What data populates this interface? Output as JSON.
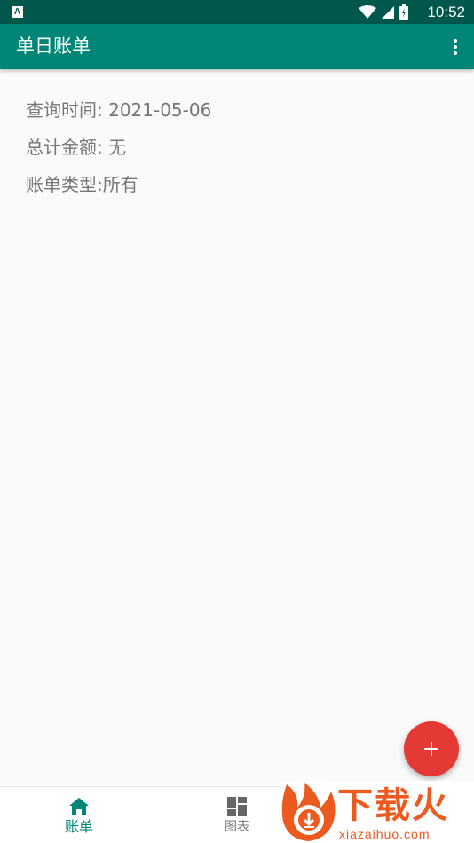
{
  "status_bar": {
    "time": "10:52",
    "notification_icon": "A"
  },
  "app_bar": {
    "title": "单日账单"
  },
  "summary": {
    "query_time": "查询时间:  2021-05-06",
    "total_amount": "总计金额:  无",
    "bill_type": "账单类型:所有"
  },
  "bottom_nav": {
    "items": [
      {
        "label": "账单",
        "icon": "home-icon",
        "active": true
      },
      {
        "label": "图表",
        "icon": "dashboard-icon",
        "active": false
      }
    ]
  },
  "watermark": {
    "title": "下载火",
    "subtitle": "xiazaihuo.com"
  },
  "colors": {
    "primary": "#008577",
    "primary_dark": "#00574b",
    "accent": "#e53935",
    "text_secondary": "#757575",
    "watermark": "#ec5a1f"
  }
}
